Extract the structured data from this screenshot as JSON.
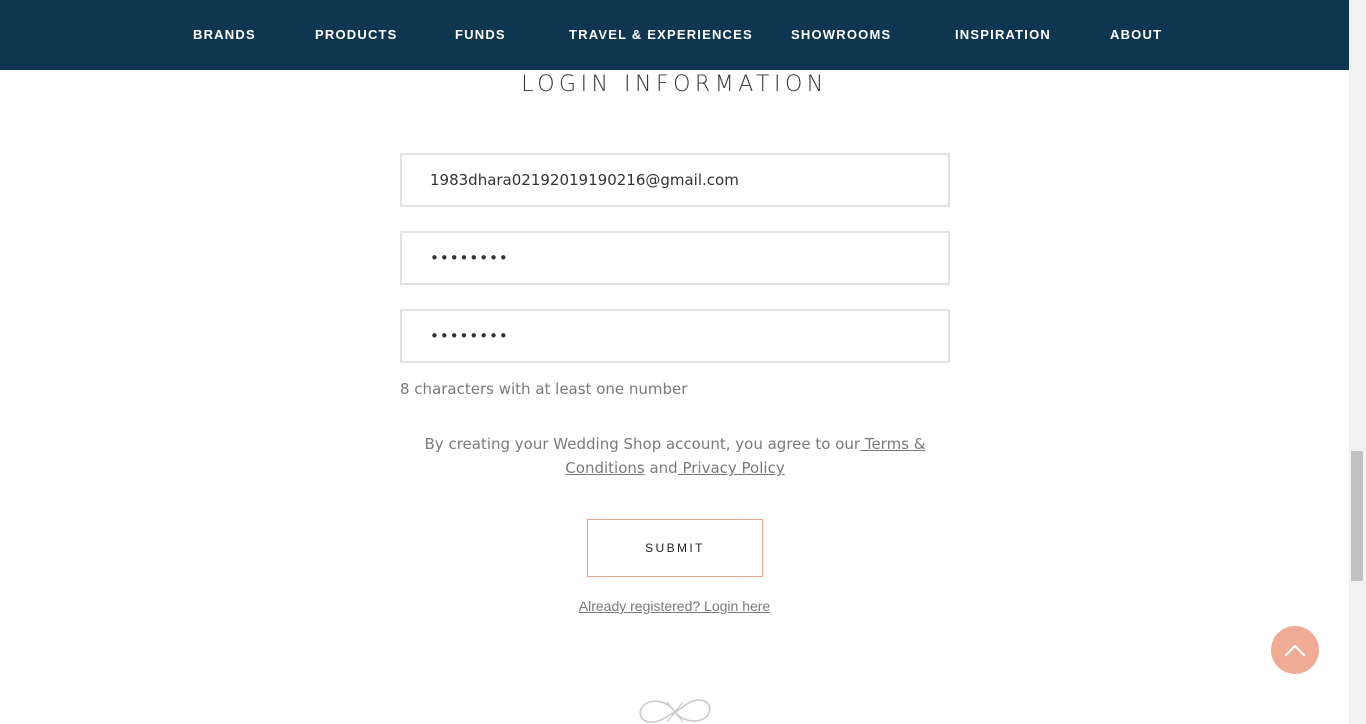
{
  "nav": {
    "items": [
      {
        "label": "BRANDS"
      },
      {
        "label": "PRODUCTS"
      },
      {
        "label": "FUNDS"
      },
      {
        "label": "TRAVEL & EXPERIENCES"
      },
      {
        "label": "SHOWROOMS"
      },
      {
        "label": "INSPIRATION"
      },
      {
        "label": "ABOUT"
      }
    ]
  },
  "form": {
    "title": "LOGIN INFORMATION",
    "email_value": "1983dhara02192019190216@gmail.com",
    "password_value": "••••••••",
    "confirm_password_value": "••••••••",
    "password_hint": "8 characters with at least one number",
    "agreement": {
      "prefix": "By creating your Wedding Shop account, you agree to our",
      "terms_label": " Terms & Conditions",
      "and": " and",
      "privacy_label": " Privacy Policy"
    },
    "submit_label": "SUBMIT",
    "login_link": "Already registered? Login here"
  },
  "colors": {
    "nav_background": "#0f3650",
    "accent": "#efab94",
    "submit_border": "#e8a48f"
  },
  "icons": {
    "back_to_top": "chevron-up-icon",
    "footer": "infinity-logo-icon"
  }
}
